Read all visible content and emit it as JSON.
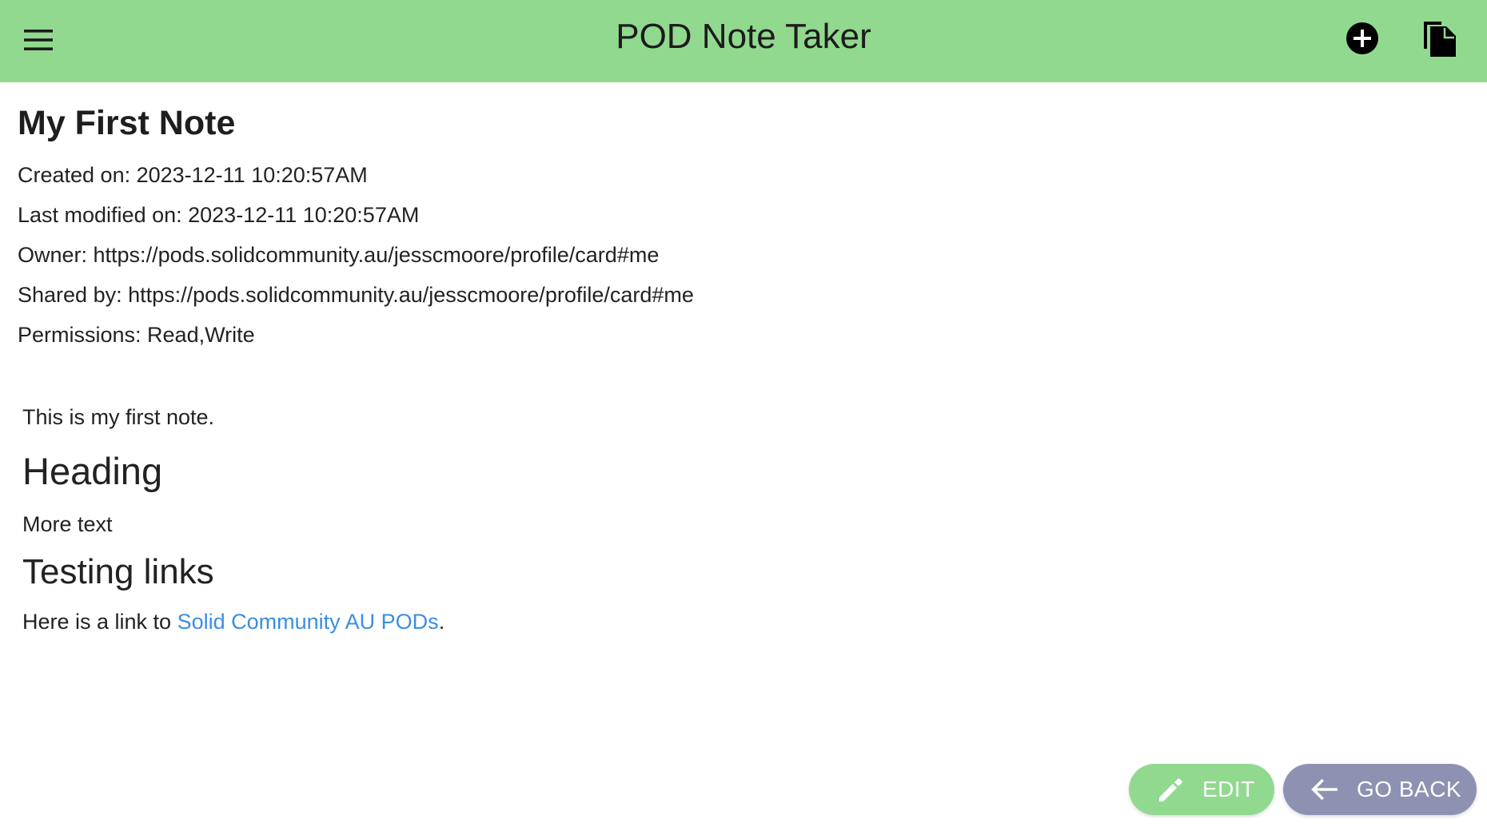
{
  "app_bar": {
    "title": "POD Note Taker",
    "menu_icon": "menu-icon",
    "add_icon": "add-circle-icon",
    "files_icon": "files-icon",
    "background_color": "#92d990"
  },
  "note": {
    "title": "My First Note",
    "created": "Created on: 2023-12-11 10:20:57AM",
    "modified": "Last modified on: 2023-12-11 10:20:57AM",
    "owner": "Owner: https://pods.solidcommunity.au/jesscmoore/profile/card#me",
    "shared_by": "Shared by: https://pods.solidcommunity.au/jesscmoore/profile/card#me",
    "permissions": "Permissions: Read,Write",
    "body": {
      "para1": "This is my first note.",
      "heading1": "Heading",
      "para2": "More text",
      "heading2": "Testing links",
      "link_prefix": "Here is a link to ",
      "link_text": "Solid Community AU PODs",
      "link_suffix": ".",
      "link_color": "#3b8ee0"
    }
  },
  "actions": {
    "edit_label": "EDIT",
    "edit_icon": "pencil-icon",
    "edit_color": "#92d990",
    "back_label": "GO BACK",
    "back_icon": "arrow-left-icon",
    "back_color": "#8d92b3"
  }
}
